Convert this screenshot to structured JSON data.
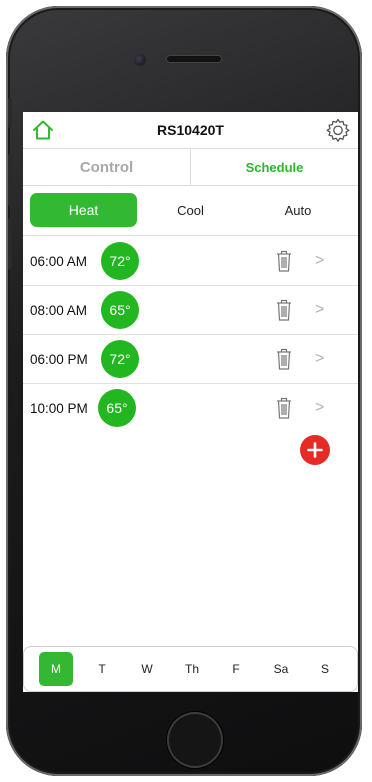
{
  "device": {
    "name": "RS10420T"
  },
  "tabs": {
    "control": "Control",
    "schedule": "Schedule"
  },
  "modes": {
    "heat": "Heat",
    "cool": "Cool",
    "auto": "Auto",
    "active": "Heat"
  },
  "schedule": [
    {
      "time": "06:00 AM",
      "temp": "72°"
    },
    {
      "time": "08:00 AM",
      "temp": "65°"
    },
    {
      "time": "06:00 PM",
      "temp": "72°"
    },
    {
      "time": "10:00 PM",
      "temp": "65°"
    }
  ],
  "row_chevron": ">",
  "days": [
    "M",
    "T",
    "W",
    "Th",
    "F",
    "Sa",
    "S"
  ],
  "active_day": "M",
  "colors": {
    "accent_green": "#33b834",
    "temp_green": "#22b720",
    "add_red": "#e52b25",
    "inactive_gray": "#a8a8a8"
  },
  "icons": {
    "home": "home-icon",
    "settings": "gear-icon",
    "delete": "trash-icon",
    "add": "plus-icon"
  }
}
